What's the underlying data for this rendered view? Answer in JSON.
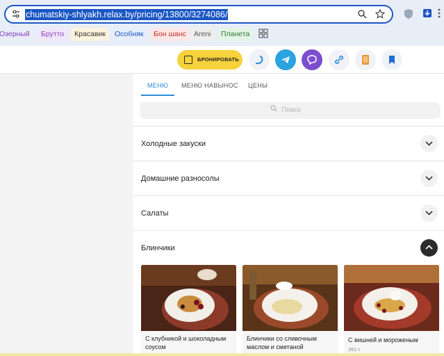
{
  "browser": {
    "url": "chumatskiy-shlyakh.relax.by/pricing/13800/3274086/",
    "bookmarks": [
      {
        "label": "Озерный",
        "bg": "#f1e7fb",
        "color": "#8a3fc2"
      },
      {
        "label": "Брутто",
        "bg": "#f1e7fb",
        "color": "#8a3fc2"
      },
      {
        "label": "Красавик",
        "bg": "#fdf4dd",
        "color": "#333333"
      },
      {
        "label": "Особняк",
        "bg": "#e6eefb",
        "color": "#1a56c4"
      },
      {
        "label": "Бон шанс",
        "bg": "#fde7e7",
        "color": "#c22a2a"
      },
      {
        "label": "Areni",
        "bg": "#eeeeee",
        "color": "#555555"
      },
      {
        "label": "Планета",
        "bg": "#e4f4e6",
        "color": "#2a7a3a"
      }
    ]
  },
  "header": {
    "book_label": "БРОНИРОВАТЬ"
  },
  "tabs": [
    {
      "label": "МЕНЮ",
      "active": true
    },
    {
      "label": "МЕНЮ НАВЫНОС",
      "active": false
    },
    {
      "label": "ЦЕНЫ",
      "active": false
    }
  ],
  "search": {
    "placeholder": "Поиск"
  },
  "sections": [
    {
      "title": "Холодные закуски",
      "expanded": false
    },
    {
      "title": "Домашние разносолы",
      "expanded": false
    },
    {
      "title": "Салаты",
      "expanded": false
    },
    {
      "title": "Блинчики",
      "expanded": true
    }
  ],
  "cards": [
    {
      "name": "С клубникой и шоколадным соусом",
      "weight": ""
    },
    {
      "name": "Блинчики со сливочным маслом и сметаной",
      "weight": ""
    },
    {
      "name": "С вишней и мороженым",
      "weight": "261 г"
    }
  ],
  "colors": {
    "accent": "#2a8ad8",
    "book_button": "#f6d23b",
    "telegram": "#2aa3df",
    "viber": "#7b4ecf"
  }
}
